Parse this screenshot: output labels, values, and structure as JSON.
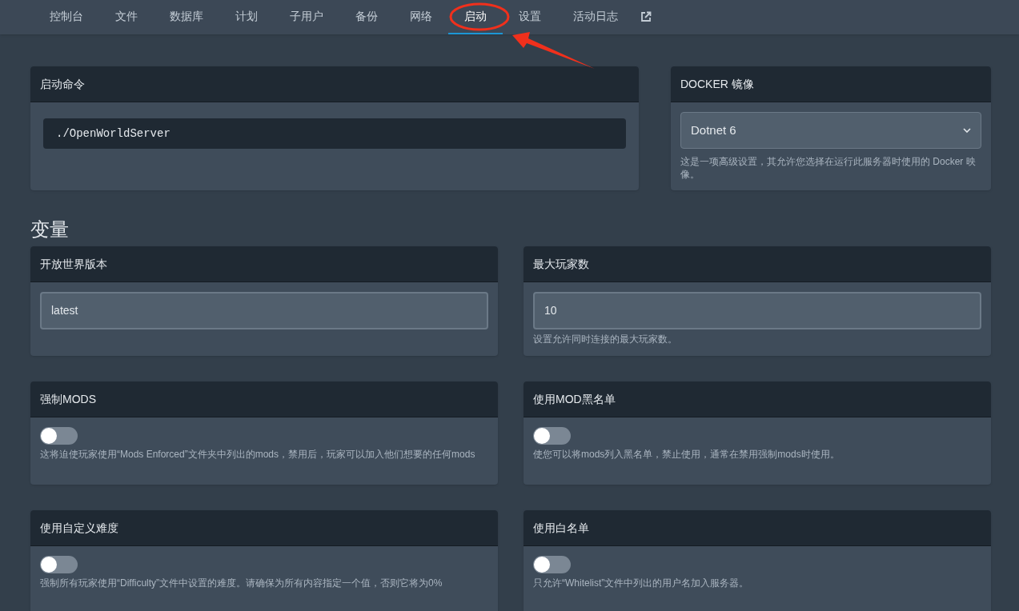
{
  "nav": {
    "tabs": [
      {
        "label": "控制台",
        "selected": false
      },
      {
        "label": "文件",
        "selected": false
      },
      {
        "label": "数据库",
        "selected": false
      },
      {
        "label": "计划",
        "selected": false
      },
      {
        "label": "子用户",
        "selected": false
      },
      {
        "label": "备份",
        "selected": false
      },
      {
        "label": "网络",
        "selected": false
      },
      {
        "label": "启动",
        "selected": true
      },
      {
        "label": "设置",
        "selected": false
      },
      {
        "label": "活动日志",
        "selected": false
      }
    ]
  },
  "startup": {
    "title": "启动命令",
    "command": "./OpenWorldServer"
  },
  "docker": {
    "title": "DOCKER 镜像",
    "value": "Dotnet 6",
    "description": "这是一项高级设置，其允许您选择在运行此服务器时使用的 Docker 映像。"
  },
  "variables_heading": "变量",
  "variables": [
    {
      "kind": "field",
      "title": "开放世界版本",
      "value": "latest"
    },
    {
      "kind": "field",
      "title": "最大玩家数",
      "value": "10",
      "description": "设置允许同时连接的最大玩家数。"
    },
    {
      "kind": "toggle",
      "title": "强制MODS",
      "on": false,
      "description": "这将迫使玩家使用“Mods Enforced”文件夹中列出的mods，禁用后，玩家可以加入他们想要的任何mods"
    },
    {
      "kind": "toggle",
      "title": "使用MOD黑名单",
      "on": false,
      "description": "使您可以将mods列入黑名单，禁止使用，通常在禁用强制mods时使用。"
    },
    {
      "kind": "toggle",
      "title": "使用自定义难度",
      "on": false,
      "description": "强制所有玩家使用“Difficulty”文件中设置的难度。请确保为所有内容指定一个值，否则它将为0%"
    },
    {
      "kind": "toggle",
      "title": "使用白名单",
      "on": false,
      "description": "只允许“Whitelist”文件中列出的用户名加入服务器。"
    }
  ]
}
